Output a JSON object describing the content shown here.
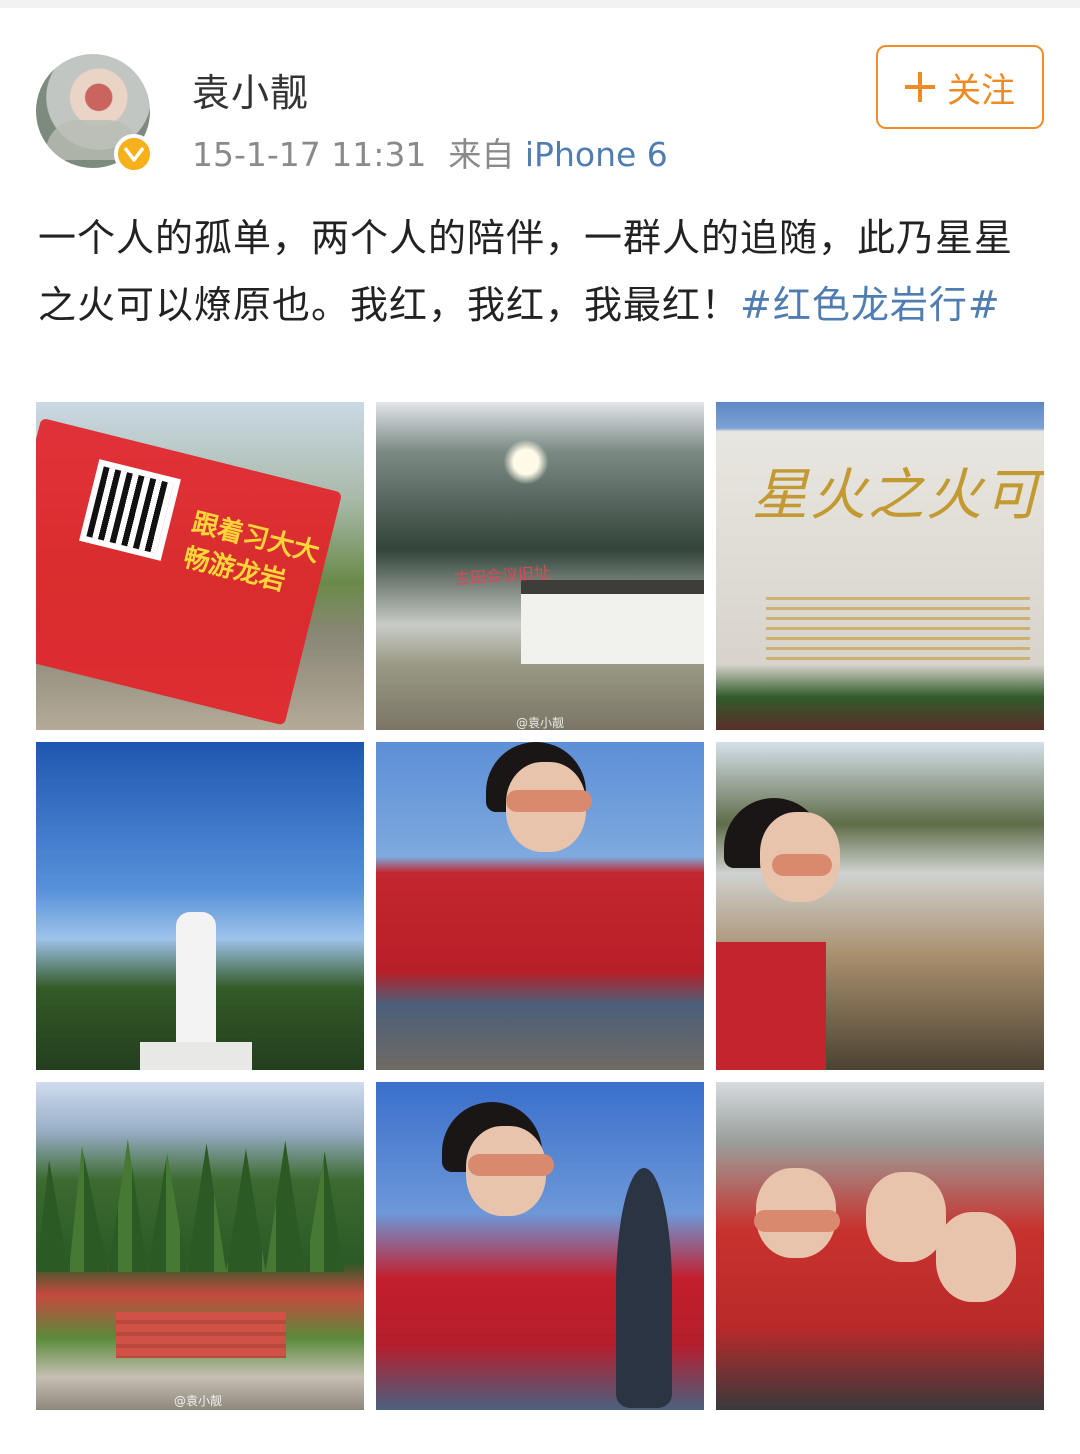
{
  "user": {
    "name": "袁小靓",
    "timestamp": "15-1-17 11:31",
    "source_prefix": "来自",
    "device": "iPhone 6"
  },
  "follow_button": {
    "label": "关注"
  },
  "post": {
    "text": "一个人的孤单，两个人的陪伴，一群人的追随，此乃星星之火可以燎原也。我红，我红，我最红！",
    "hashtag": "#红色龙岩行#"
  },
  "photos": [
    {
      "name": "flyer-photo",
      "text": "跟着习大大 畅游龙岩"
    },
    {
      "name": "memorial-hall-photo",
      "text": "古田会议旧址",
      "watermark": "@袁小靓"
    },
    {
      "name": "calligraphy-wall-photo",
      "text": "星火之火可以燎原"
    },
    {
      "name": "statue-photo"
    },
    {
      "name": "selfie-sitting-photo"
    },
    {
      "name": "selfie-path-photo"
    },
    {
      "name": "plaza-photo",
      "watermark": "@袁小靓"
    },
    {
      "name": "selfie-man-photo"
    },
    {
      "name": "group-selfie-photo"
    }
  ],
  "colors": {
    "link": "#4f7db2",
    "follow_accent": "#f08a22",
    "verified_badge": "#f6b01b"
  }
}
